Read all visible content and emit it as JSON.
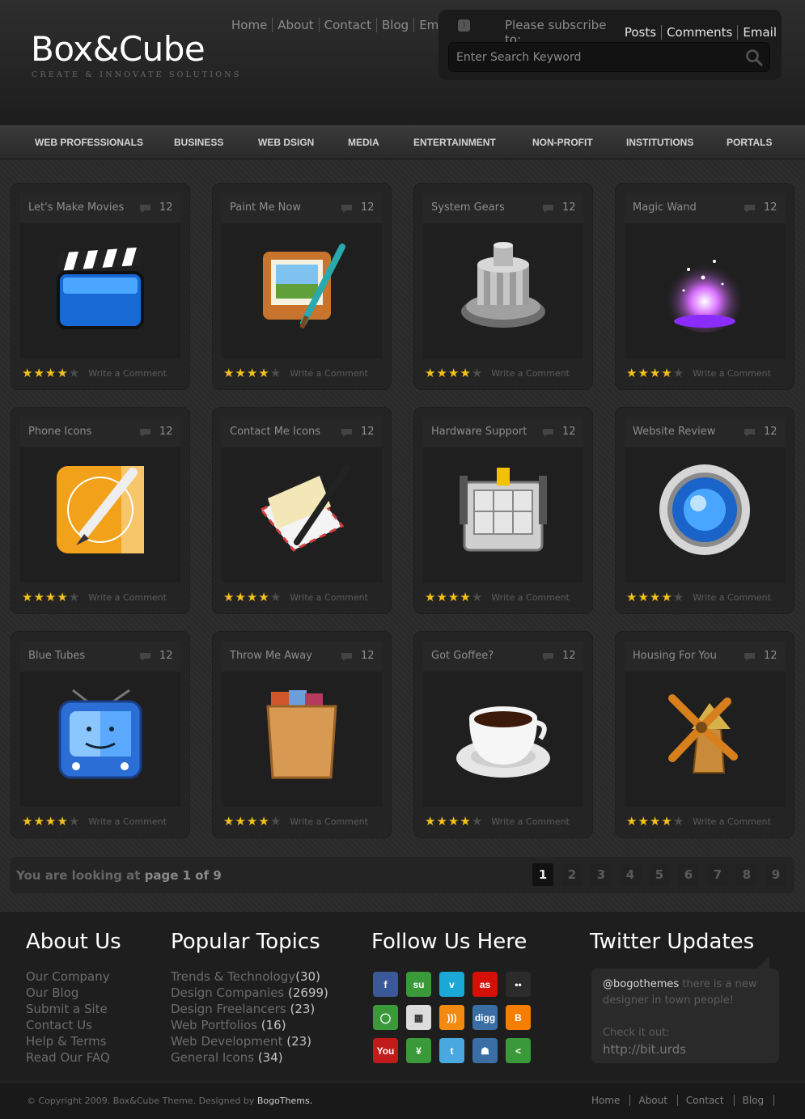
{
  "header": {
    "logo_title": "Box&Cube",
    "logo_tagline": "CREATE & INNOVATE SOLUTIONS",
    "top_nav": [
      "Home",
      "About",
      "Contact",
      "Blog",
      "Email"
    ],
    "subscribe_label": "Please subscribe to:",
    "subscribe_links": [
      "Posts",
      "Comments",
      "Email"
    ],
    "search_placeholder": "Enter Search Keyword"
  },
  "category_nav": [
    "WEB PROFESSIONALS",
    "BUSINESS",
    "WEB DSIGN",
    "MEDIA",
    "ENTERTAINMENT",
    "NON-PROFIT",
    "INSTITUTIONS",
    "PORTALS"
  ],
  "cards": [
    {
      "title": "Let's Make Movies",
      "comments": "12",
      "rating": 4,
      "icon": "clapperboard-icon",
      "link": "Write a Comment"
    },
    {
      "title": "Paint Me Now",
      "comments": "12",
      "rating": 4,
      "icon": "paint-brush-icon",
      "link": "Write a Comment"
    },
    {
      "title": "System Gears",
      "comments": "12",
      "rating": 4,
      "icon": "gear-icon",
      "link": "Write a Comment"
    },
    {
      "title": "Magic Wand",
      "comments": "12",
      "rating": 4,
      "icon": "magic-sparkle-icon",
      "link": "Write a Comment"
    },
    {
      "title": "Phone Icons",
      "comments": "12",
      "rating": 4,
      "icon": "pen-nib-icon",
      "link": "Write a Comment"
    },
    {
      "title": "Contact Me Icons",
      "comments": "12",
      "rating": 4,
      "icon": "envelope-pen-icon",
      "link": "Write a Comment"
    },
    {
      "title": "Hardware Support",
      "comments": "12",
      "rating": 4,
      "icon": "hard-drive-icon",
      "link": "Write a Comment"
    },
    {
      "title": "Website Review",
      "comments": "12",
      "rating": 4,
      "icon": "globe-lens-icon",
      "link": "Write a Comment"
    },
    {
      "title": "Blue Tubes",
      "comments": "12",
      "rating": 4,
      "icon": "tv-finder-icon",
      "link": "Write a Comment"
    },
    {
      "title": "Throw Me Away",
      "comments": "12",
      "rating": 4,
      "icon": "bin-box-icon",
      "link": "Write a Comment"
    },
    {
      "title": "Got Goffee?",
      "comments": "12",
      "rating": 4,
      "icon": "coffee-cup-icon",
      "link": "Write a Comment"
    },
    {
      "title": "Housing For You",
      "comments": "12",
      "rating": 4,
      "icon": "windmill-icon",
      "link": "Write a Comment"
    }
  ],
  "pager": {
    "prefix": "You are looking at",
    "page_label": "page 1 of 9",
    "pages": [
      "1",
      "2",
      "3",
      "4",
      "5",
      "6",
      "7",
      "8",
      "9"
    ],
    "current": "1"
  },
  "footer": {
    "about": {
      "title": "About Us",
      "items": [
        "Our Company",
        "Our Blog",
        "Submit a Site",
        "Contact Us",
        "Help & Terms",
        "Read Our FAQ"
      ]
    },
    "topics": {
      "title": "Popular Topics",
      "items": [
        {
          "label": "Trends & Technology",
          "count": "(30)"
        },
        {
          "label": "Design Companies ",
          "count": "(2699)"
        },
        {
          "label": "Design Freelancers ",
          "count": "(23)"
        },
        {
          "label": "Web Portfolios ",
          "count": "(16)"
        },
        {
          "label": "Web Development ",
          "count": "(23)"
        },
        {
          "label": "General Icons ",
          "count": "(34)"
        }
      ]
    },
    "follow": {
      "title": "Follow Us Here",
      "icons": [
        {
          "name": "facebook-icon",
          "glyph": "f",
          "color": "#3b5998"
        },
        {
          "name": "stumbleupon-icon",
          "glyph": "su",
          "color": "#3a9a3a"
        },
        {
          "name": "vimeo-icon",
          "glyph": "v",
          "color": "#1aa8d6"
        },
        {
          "name": "lastfm-icon",
          "glyph": "as",
          "color": "#d51007"
        },
        {
          "name": "flickr-icon",
          "glyph": "••",
          "color": "#2b2b2b"
        },
        {
          "name": "chat-icon",
          "glyph": "◯",
          "color": "#3a9a3a"
        },
        {
          "name": "delicious-icon",
          "glyph": "▦",
          "color": "#dddddd"
        },
        {
          "name": "rss-feed-icon",
          "glyph": ")))",
          "color": "#f28a12"
        },
        {
          "name": "digg-icon",
          "glyph": "digg",
          "color": "#3a6ea5"
        },
        {
          "name": "blogger-icon",
          "glyph": "B",
          "color": "#f57d00"
        },
        {
          "name": "youtube-icon",
          "glyph": "You",
          "color": "#c21b1b"
        },
        {
          "name": "tree-icon",
          "glyph": "¥",
          "color": "#3a9a3a"
        },
        {
          "name": "twitter-icon",
          "glyph": "t",
          "color": "#4aa8e0"
        },
        {
          "name": "myspace-icon",
          "glyph": "☗",
          "color": "#3a6ea5"
        },
        {
          "name": "share-icon",
          "glyph": "<",
          "color": "#3a9a3a"
        }
      ]
    },
    "twitter": {
      "title": "Twitter Updates",
      "user": "@bogothemes",
      "text": " there is a new designer in town people!",
      "check": "Check it out:",
      "link": "http://bit.urds"
    }
  },
  "bottom": {
    "copyright_prefix": "© Copyright 2009. Box&Cube Theme. Designed by ",
    "brand": "BogoThems.",
    "nav": [
      "Home",
      "About",
      "Contact",
      "Blog"
    ]
  },
  "colors": {
    "accent_star": "#f3c21b",
    "background": "#262626"
  }
}
